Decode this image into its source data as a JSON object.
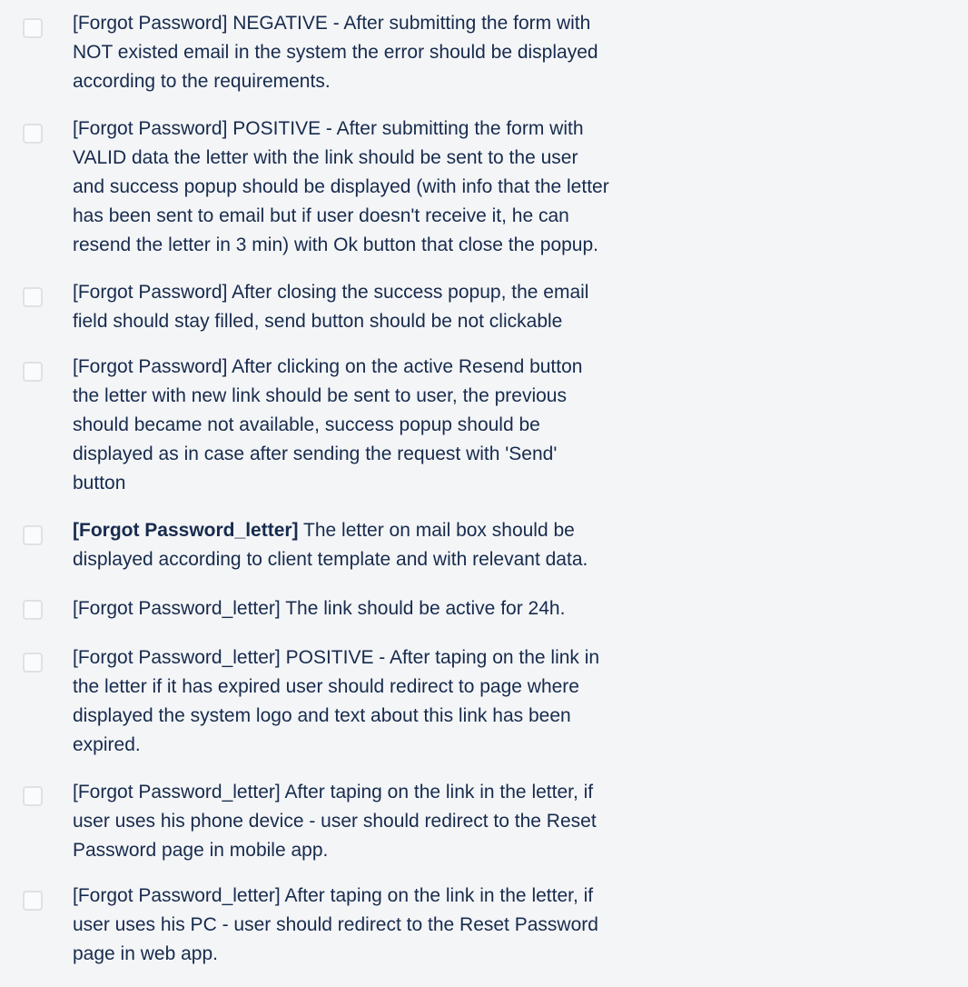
{
  "checklist": {
    "items": [
      {
        "checked": false,
        "lines": [
          "[Forgot Password] NEGATIVE - After submitting the form with",
          "NOT existed email in the system the error should be displayed",
          "according to the requirements."
        ]
      },
      {
        "checked": false,
        "lines": [
          "[Forgot Password] POSITIVE - After submitting the form with",
          "VALID data the letter with the link should be sent to the user",
          "and success popup should be displayed (with info that the letter",
          "has been sent to email but if user doesn't receive it, he can",
          "resend the letter in 3 min) with Ok button that close the popup."
        ]
      },
      {
        "checked": false,
        "lines": [
          "[Forgot Password] After closing the success popup, the email",
          "field should stay filled, send button should be not clickable"
        ]
      },
      {
        "checked": false,
        "lines": [
          "[Forgot Password] After clicking on the active Resend button",
          "the letter with new link should be sent to user, the previous",
          "should became not available, success popup should be",
          "displayed as in case after sending the request with 'Send'",
          "button"
        ]
      },
      {
        "checked": false,
        "bold_prefix": "[Forgot Password_letter]",
        "first_line_rest": " The letter on mail box should be",
        "lines": [
          "displayed according to client template and with relevant data."
        ]
      },
      {
        "checked": false,
        "lines": [
          "[Forgot Password_letter] The link should be active for 24h."
        ]
      },
      {
        "checked": false,
        "lines": [
          "[Forgot Password_letter] POSITIVE - After taping on the link in",
          "the letter if it has expired user should redirect to page where",
          "displayed the system logo and text about this link has been",
          "expired."
        ]
      },
      {
        "checked": false,
        "lines": [
          "[Forgot Password_letter] After taping on the link in the letter, if",
          "user uses his phone device - user should redirect to the Reset",
          "Password page in mobile app."
        ]
      },
      {
        "checked": false,
        "lines": [
          "[Forgot Password_letter] After taping on the link in the letter, if",
          "user uses his PC - user should redirect to the Reset Password",
          "page in web app."
        ]
      }
    ]
  },
  "colors": {
    "background": "#f4f5f7",
    "text": "#172b4d",
    "checkbox_border": "#dfe1e6",
    "checkbox_fill": "#fafbfc"
  }
}
